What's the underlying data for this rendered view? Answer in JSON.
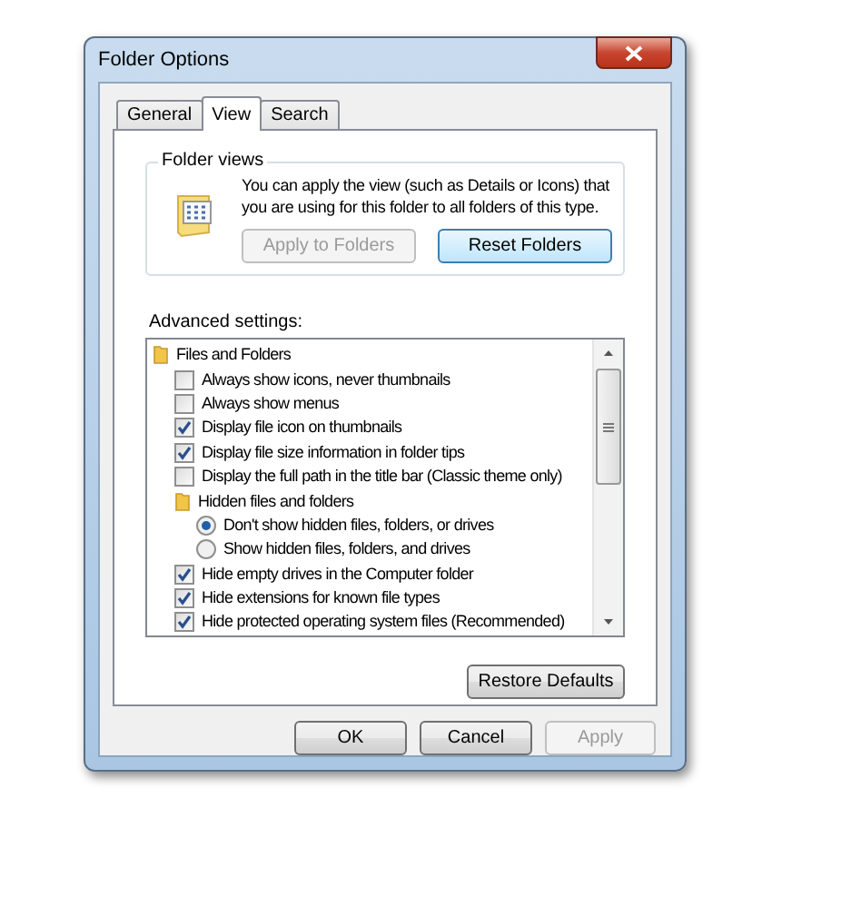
{
  "window": {
    "title": "Folder Options"
  },
  "tabs": [
    {
      "label": "General",
      "selected": false
    },
    {
      "label": "View",
      "selected": true
    },
    {
      "label": "Search",
      "selected": false
    }
  ],
  "folder_views": {
    "title": "Folder views",
    "description": "You can apply the view (such as Details or Icons) that you are using for this folder to all folders of this type.",
    "buttons": [
      {
        "label": "Apply to Folders",
        "disabled": true,
        "focused": false
      },
      {
        "label": "Reset Folders",
        "disabled": false,
        "focused": true
      }
    ]
  },
  "advanced": {
    "label": "Advanced settings:",
    "items": [
      {
        "kind": "folder",
        "label": "Files and Folders",
        "children": [
          {
            "kind": "checkbox",
            "label": "Always show icons, never thumbnails",
            "checked": false
          },
          {
            "kind": "checkbox",
            "label": "Always show menus",
            "checked": false
          },
          {
            "kind": "checkbox",
            "label": "Display file icon on thumbnails",
            "checked": true
          },
          {
            "kind": "checkbox",
            "label": "Display file size information in folder tips",
            "checked": true
          },
          {
            "kind": "checkbox",
            "label": "Display the full path in the title bar (Classic theme only)",
            "checked": false
          },
          {
            "kind": "folder",
            "label": "Hidden files and folders",
            "children": [
              {
                "kind": "radio",
                "label": "Don't show hidden files, folders, or drives",
                "selected": true
              },
              {
                "kind": "radio",
                "label": "Show hidden files, folders, and drives",
                "selected": false
              }
            ]
          },
          {
            "kind": "checkbox",
            "label": "Hide empty drives in the Computer folder",
            "checked": true
          },
          {
            "kind": "checkbox",
            "label": "Hide extensions for known file types",
            "checked": true
          },
          {
            "kind": "checkbox",
            "label": "Hide protected operating system files (Recommended)",
            "checked": true
          }
        ]
      }
    ]
  },
  "restore_button": {
    "label": "Restore Defaults"
  },
  "buttons": [
    {
      "label": "OK",
      "disabled": false
    },
    {
      "label": "Cancel",
      "disabled": false
    },
    {
      "label": "Apply",
      "disabled": true
    }
  ]
}
